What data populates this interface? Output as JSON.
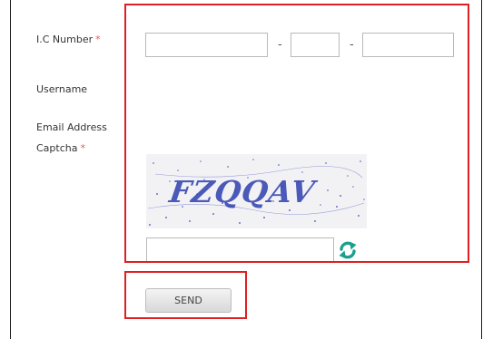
{
  "form": {
    "ic_number": {
      "label": "I.C Number",
      "required_mark": "*",
      "separator": "-",
      "part1": "",
      "part2": "",
      "part3": ""
    },
    "username": {
      "label": "Username"
    },
    "email": {
      "label": "Email Address"
    },
    "captcha": {
      "label": "Captcha",
      "required_mark": "*",
      "image_text": "FZQQAV",
      "input": ""
    }
  },
  "actions": {
    "send_label": "SEND"
  },
  "colors": {
    "highlight": "#e02020",
    "required": "#e35b5b",
    "refresh_icon": "#1aa08e"
  },
  "icons": {
    "refresh": "refresh-icon"
  }
}
